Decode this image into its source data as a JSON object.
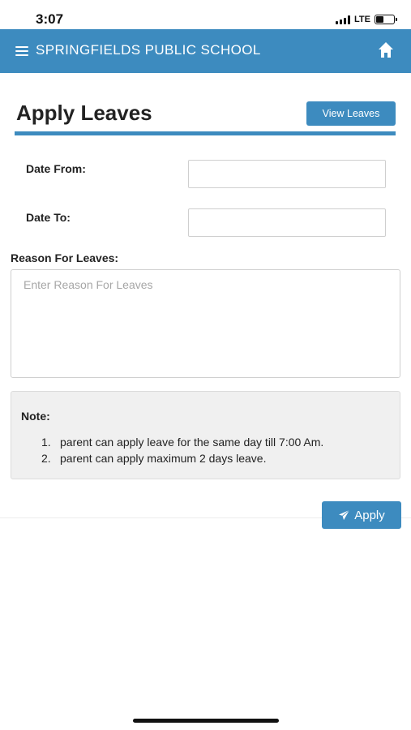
{
  "status_bar": {
    "time": "3:07",
    "network": "LTE",
    "battery_level": 0.4
  },
  "header": {
    "title": "SPRINGFIELDS PUBLIC SCHOOL",
    "menu_icon": "hamburger-menu-icon",
    "home_icon": "home-icon"
  },
  "page": {
    "title": "Apply Leaves",
    "view_leaves_label": "View Leaves"
  },
  "form": {
    "date_from_label": "Date From:",
    "date_from_value": "",
    "date_to_label": "Date To:",
    "date_to_value": "",
    "reason_label": "Reason For Leaves:",
    "reason_placeholder": "Enter Reason For Leaves",
    "reason_value": ""
  },
  "note": {
    "heading": "Note:",
    "items": [
      {
        "num": "1.",
        "text": "parent can apply leave for the same day till 7:00 Am."
      },
      {
        "num": "2.",
        "text": "parent can apply maximum 2 days leave."
      }
    ]
  },
  "actions": {
    "apply_label": "Apply",
    "apply_icon": "send-icon"
  },
  "colors": {
    "primary": "#3d8bbf",
    "note_bg": "#f0f0f0",
    "placeholder": "#a6a6a6"
  }
}
